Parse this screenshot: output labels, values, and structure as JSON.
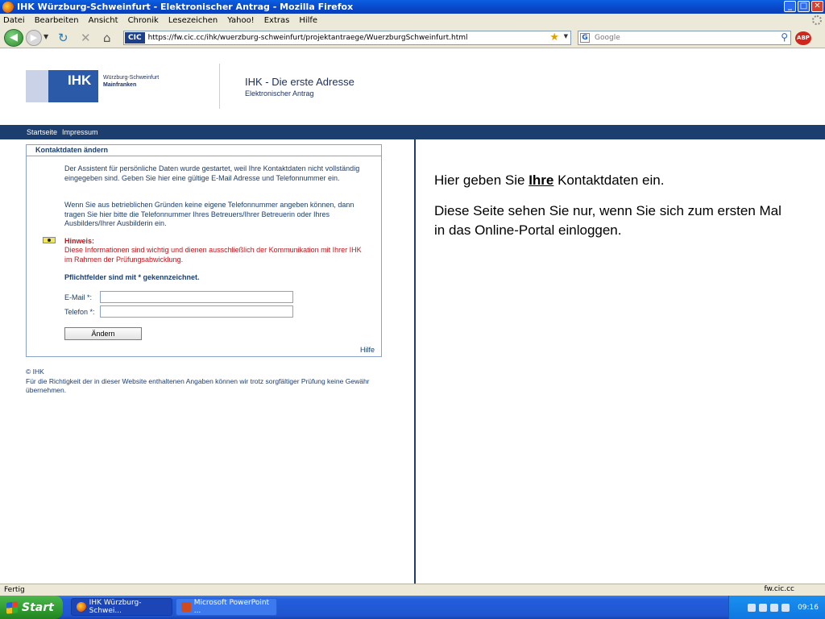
{
  "window": {
    "title": "IHK Würzburg-Schweinfurt - Elektronischer Antrag - Mozilla Firefox",
    "controls": {
      "minimize": "_",
      "maximize": "□",
      "close": "✕"
    }
  },
  "menu": [
    "Datei",
    "Bearbeiten",
    "Ansicht",
    "Chronik",
    "Lesezeichen",
    "Yahoo!",
    "Extras",
    "Hilfe"
  ],
  "toolbar": {
    "site_badge": "CIC",
    "url": "https://fw.cic.cc/ihk/wuerzburg-schweinfurt/projektantraege/WuerzburgSchweinfurt.html",
    "search_placeholder": "Google",
    "abp_label": "ABP"
  },
  "header": {
    "logo_text": "IHK",
    "logo_region": "Würzburg-Schweinfurt",
    "logo_region2": "Mainfranken",
    "title": "IHK - Die erste Adresse",
    "subtitle": "Elektronischer Antrag"
  },
  "nav": [
    "Startseite",
    "Impressum"
  ],
  "form": {
    "title": "Kontaktdaten ändern",
    "para1": "Der Assistent für persönliche Daten wurde gestartet, weil Ihre Kontaktdaten nicht vollständig eingegeben sind. Geben Sie hier eine gültige E-Mail Adresse und Telefonnummer ein.",
    "para2": "Wenn Sie aus betrieblichen Gründen keine eigene Telefonnummer angeben können, dann tragen Sie hier bitte die Telefonnummer Ihres Betreuers/Ihrer Betreuerin oder Ihres Ausbilders/Ihrer Ausbilderin ein.",
    "hint_title": "Hinweis:",
    "hint_text": "Diese Informationen sind wichtig und dienen ausschließlich der Kommunikation mit Ihrer IHK im Rahmen der Prüfungsabwicklung.",
    "required_note": "Pflichtfelder sind mit * gekennzeichnet.",
    "email_label": "E-Mail *:",
    "email_value": "",
    "phone_label": "Telefon *:",
    "phone_value": "",
    "submit_label": "Ändern",
    "help_link": "Hilfe"
  },
  "footer": {
    "copyright": "© IHK",
    "disclaimer": "Für die Richtigkeit der in dieser Website enthaltenen Angaben können wir trotz sorgfältiger Prüfung keine Gewähr übernehmen."
  },
  "annotation": {
    "line1_pre": "Hier geben Sie ",
    "line1_bold": "Ihre",
    "line1_post": " Kontaktdaten ein.",
    "line2": "Diese Seite sehen Sie nur, wenn Sie sich zum ersten Mal in das Online-Portal einloggen."
  },
  "status": {
    "text": "Fertig",
    "domain": "fw.cic.cc"
  },
  "taskbar": {
    "start_label": "Start",
    "tasks": [
      "IHK Würzburg-Schwei...",
      "Microsoft PowerPoint ..."
    ],
    "clock": "09:16"
  },
  "colors": {
    "brand_blue": "#1b3e6f",
    "warning_red": "#c0161c",
    "panel_border": "#8aa2c8"
  }
}
